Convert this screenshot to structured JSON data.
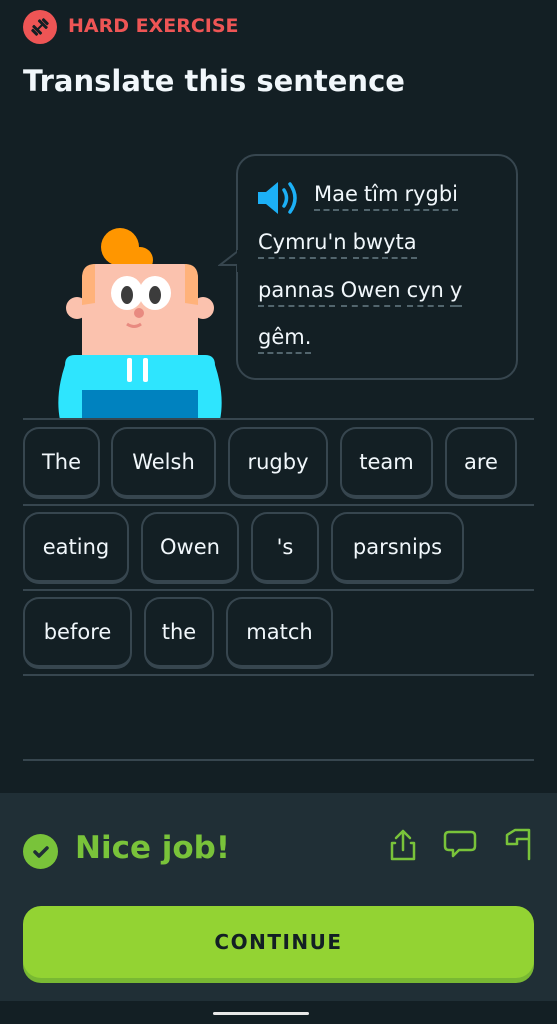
{
  "header": {
    "badge": "HARD EXERCISE",
    "badge_icon": "dumbbell-icon",
    "title": "Translate this sentence"
  },
  "prompt": {
    "lines": [
      [
        "Mae",
        "tîm",
        "rygbi"
      ],
      [
        "Cymru'n",
        "bwyta"
      ],
      [
        "pannas",
        "Owen",
        "cyn",
        "y"
      ],
      [
        "gêm."
      ]
    ],
    "speaker_icon": "speaker-icon"
  },
  "word_bank": {
    "rows": [
      [
        "The",
        "Welsh",
        "rugby",
        "team",
        "are"
      ],
      [
        "eating",
        "Owen",
        "'s",
        "parsnips"
      ],
      [
        "before",
        "the",
        "match"
      ]
    ]
  },
  "feedback": {
    "message": "Nice job!",
    "continue": "CONTINUE",
    "icons": [
      "share-icon",
      "comment-icon",
      "flag-icon"
    ]
  },
  "colors": {
    "background": "#131f24",
    "accent_green": "#93d333",
    "success_text": "#79c33a",
    "hard_red": "#ee5555",
    "speaker_blue": "#1cb0f6"
  }
}
